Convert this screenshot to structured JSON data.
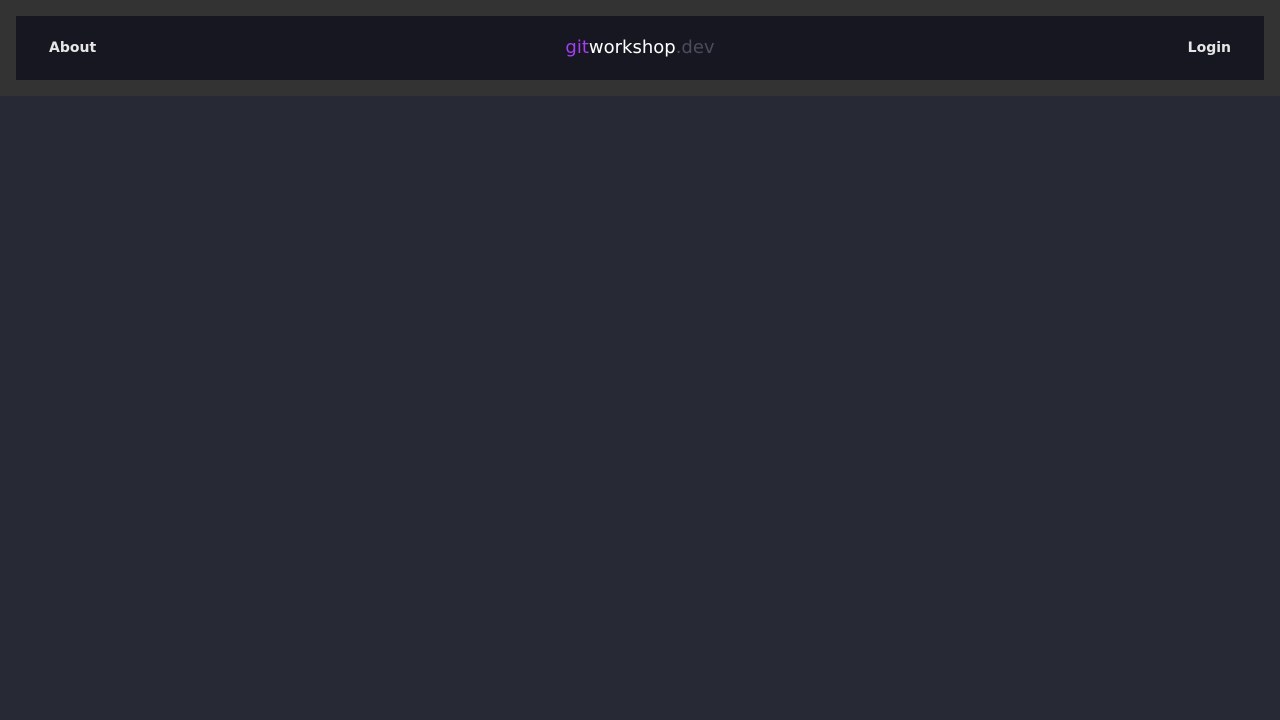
{
  "nav": {
    "about_label": "About",
    "login_label": "Login",
    "brand": {
      "part1": "git",
      "part2": "workshop",
      "part3": ".dev"
    }
  },
  "colors": {
    "page_background": "#272935",
    "topbar_frame": "#333333",
    "navbar_background": "#171721",
    "brand_accent": "#a33ff0",
    "brand_main": "#ffffff",
    "brand_muted": "#4b4b5e",
    "nav_text": "#e6e6e6"
  }
}
